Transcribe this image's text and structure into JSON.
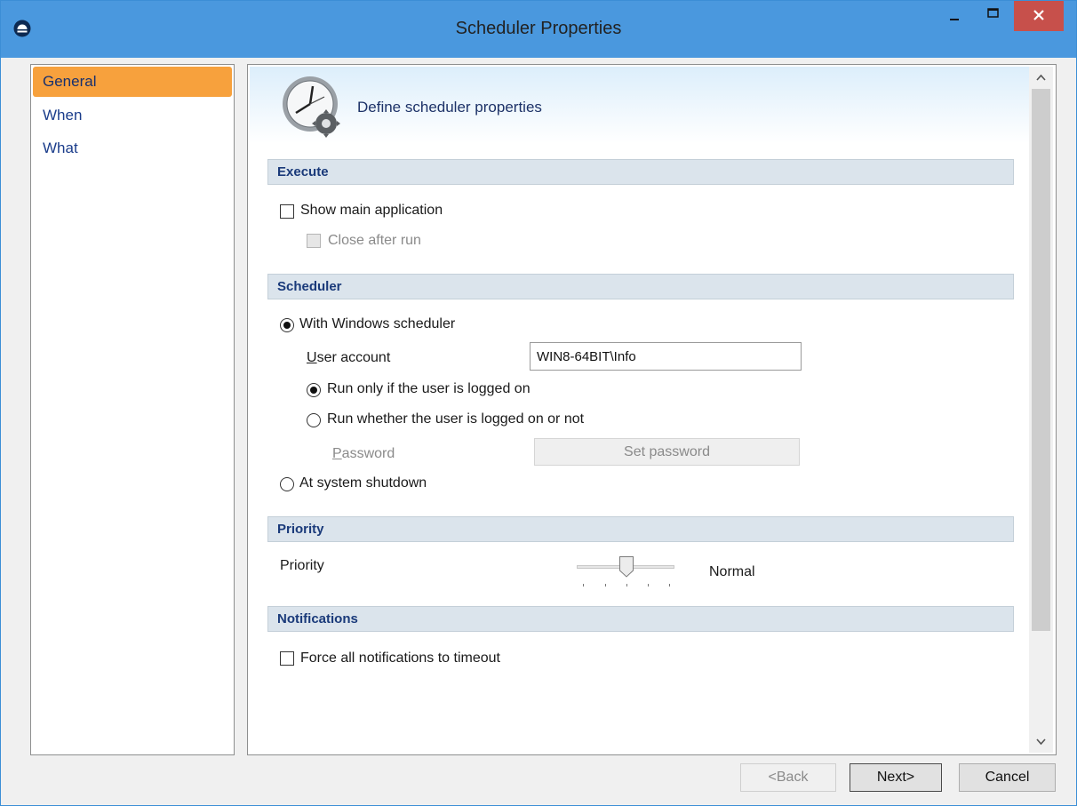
{
  "window": {
    "title": "Scheduler Properties",
    "colors": {
      "titlebar": "#4a98de",
      "close_button": "#c7504b",
      "active_nav": "#f7a13d",
      "section_header": "#dbe4ec"
    }
  },
  "sidebar": {
    "items": [
      {
        "label": "General",
        "selected": true
      },
      {
        "label": "When",
        "selected": false
      },
      {
        "label": "What",
        "selected": false
      }
    ]
  },
  "header": {
    "text": "Define scheduler properties",
    "icon": "clock-gear-icon"
  },
  "sections": {
    "execute": {
      "title": "Execute",
      "show_main_app": {
        "label": "Show main application",
        "checked": false
      },
      "close_after_run": {
        "label": "Close after run",
        "checked": false,
        "enabled": false
      }
    },
    "scheduler": {
      "title": "Scheduler",
      "with_windows": {
        "label": "With Windows scheduler",
        "selected": true
      },
      "user_account": {
        "label_u": "U",
        "label_rest": "ser account",
        "value": "WIN8-64BIT\\Info"
      },
      "run_logged_on": {
        "label": "Run only if the user is logged on",
        "selected": true
      },
      "run_whether": {
        "label": "Run whether the user is logged on or not",
        "selected": false
      },
      "password": {
        "label_u": "P",
        "label_rest": "assword",
        "button": "Set password",
        "enabled": false
      },
      "at_shutdown": {
        "label": "At system shutdown",
        "selected": false
      }
    },
    "priority": {
      "title": "Priority",
      "label": "Priority",
      "value_text": "Normal",
      "level": 3,
      "levels": 5
    },
    "notifications": {
      "title": "Notifications",
      "force_timeout": {
        "label": "Force all notifications to timeout",
        "checked": false
      }
    }
  },
  "footer": {
    "back": "<Back",
    "next": "Next>",
    "cancel": "Cancel"
  }
}
